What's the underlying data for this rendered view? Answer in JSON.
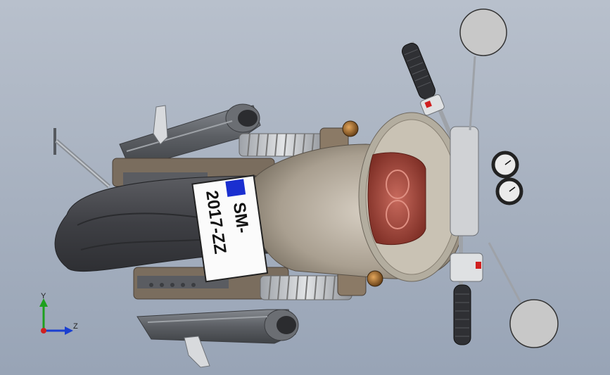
{
  "scene": {
    "plate": {
      "line1": "SM-",
      "line2": "2017-ZZ"
    },
    "triad": {
      "x_label": "Z",
      "y_label": "Y"
    },
    "colors": {
      "background": "#a6b0bf",
      "tire": "#4a4b50",
      "exhaust": "#5a5d62",
      "tank": "#b5ab9c",
      "taillight": "#b04a3d",
      "plate_flag": "#1a2fd0",
      "mirror": "#c8c8c8",
      "triad_y": "#1ea01e",
      "triad_z": "#1a3fd0",
      "triad_origin": "#d02020"
    }
  }
}
